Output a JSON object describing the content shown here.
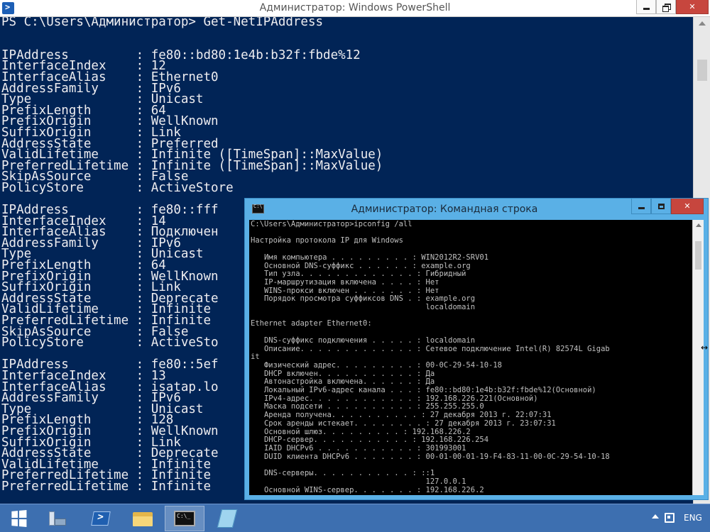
{
  "powershell": {
    "title": "Администратор: Windows PowerShell",
    "content": "PS C:\\Users\\Администратор> Get-NetIPAddress\n\n\nIPAddress         : fe80::bd80:1e4b:b32f:fbde%12\nInterfaceIndex    : 12\nInterfaceAlias    : Ethernet0\nAddressFamily     : IPv6\nType              : Unicast\nPrefixLength      : 64\nPrefixOrigin      : WellKnown\nSuffixOrigin      : Link\nAddressState      : Preferred\nValidLifetime     : Infinite ([TimeSpan]::MaxValue)\nPreferredLifetime : Infinite ([TimeSpan]::MaxValue)\nSkipAsSource      : False\nPolicyStore       : ActiveStore\n\nIPAddress         : fe80::fff\nInterfaceIndex    : 14\nInterfaceAlias    : Подключен\nAddressFamily     : IPv6\nType              : Unicast\nPrefixLength      : 64\nPrefixOrigin      : WellKnown\nSuffixOrigin      : Link\nAddressState      : Deprecate\nValidLifetime     : Infinite\nPreferredLifetime : Infinite\nSkipAsSource      : False\nPolicyStore       : ActiveSto\n\nIPAddress         : fe80::5ef\nInterfaceIndex    : 13\nInterfaceAlias    : isatap.lo\nAddressFamily     : IPv6\nType              : Unicast\nPrefixLength      : 128\nPrefixOrigin      : WellKnown\nSuffixOrigin      : Link\nAddressState      : Deprecate\nValidLifetime     : Infinite\nPreferredLifetime : Infinite\nPreferredLifetime : Infinite"
  },
  "cmd": {
    "title": "Администратор: Командная строка",
    "content": "C:\\Users\\Администратор>ipconfig /all\n\nНастройка протокола IP для Windows\n\n   Имя компьютера . . . . . . . . . : WIN2012R2-SRV01\n   Основной DNS-суффикс . . . . . . : example.org\n   Тип узла. . . . . . . . . . . . . : Гибридный\n   IP-маршрутизация включена . . . . : Нет\n   WINS-прокси включен . . . . . . . : Нет\n   Порядок просмотра суффиксов DNS . : example.org\n                                       localdomain\n\nEthernet adapter Ethernet0:\n\n   DNS-суффикс подключения . . . . . : localdomain\n   Описание. . . . . . . . . . . . . : Сетевое подключение Intel(R) 82574L Gigab\nit\n   Физический адрес. . . . . . . . . : 00-0C-29-54-10-18\n   DHCP включен. . . . . . . . . . . : Да\n   Автонастройка включена. . . . . . : Да\n   Локальный IPv6-адрес канала . . . : fe80::bd80:1e4b:b32f:fbde%12(Основной)\n   IPv4-адрес. . . . . . . . . . . . : 192.168.226.221(Основной)\n   Маска подсети . . . . . . . . . . : 255.255.255.0\n   Аренда получена. . . . . . . . . . : 27 декабря 2013 г. 22:07:31\n   Срок аренды истекает. . . . . . . . : 27 декабря 2013 г. 23:07:31\n   Основной шлюз. . . . . . . . . : 192.168.226.2\n   DHCP-сервер. . . . . . . . . . . : 192.168.226.254\n   IAID DHCPv6 . . . . . . . . . . . : 301993001\n   DUID клиента DHCPv6 . . . . . . . : 00-01-00-01-19-F4-83-11-00-0C-29-54-10-18\n\n   DNS-серверы. . . . . . . . . . . : ::1\n                                       127.0.0.1\n   Основной WINS-сервер. . . . . . . : 192.168.226.2"
  },
  "ps_right_edge_chars": "e\n\nT\nI",
  "taskbar": {
    "language": "ENG",
    "items": [
      "start",
      "server-manager",
      "powershell",
      "file-explorer",
      "command-prompt",
      "notepad"
    ]
  }
}
